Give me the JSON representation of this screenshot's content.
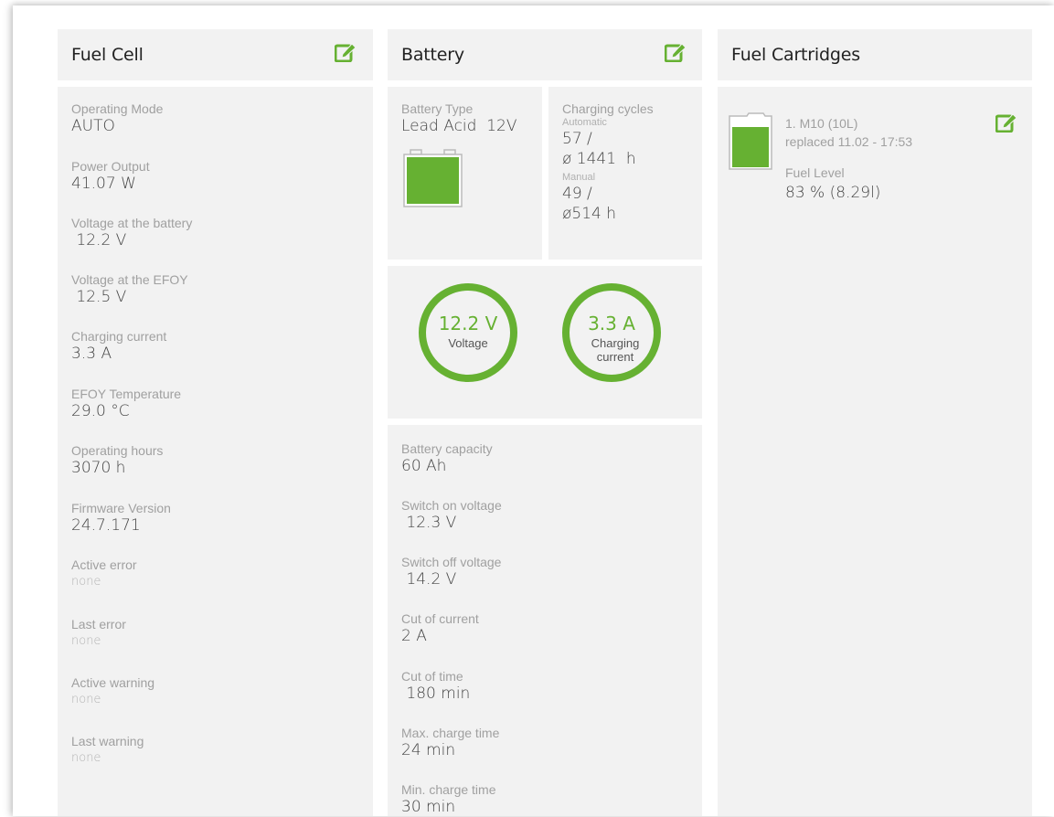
{
  "fuel_cell": {
    "title": "Fuel Cell",
    "fields": [
      {
        "label": "Operating Mode",
        "value": "AUTO"
      },
      {
        "label": "Power Output",
        "value": "41.07 W"
      },
      {
        "label": "Voltage at the battery",
        "value": " 12.2 V"
      },
      {
        "label": "Voltage at the EFOY",
        "value": " 12.5 V"
      },
      {
        "label": "Charging current",
        "value": "3.3 A"
      },
      {
        "label": "EFOY Temperature",
        "value": "29.0 °C"
      },
      {
        "label": "Operating hours",
        "value": "3070 h"
      },
      {
        "label": "Firmware Version",
        "value": "24.7.171"
      },
      {
        "label": "Active error",
        "value": "none"
      },
      {
        "label": "Last error",
        "value": "none"
      },
      {
        "label": "Active warning",
        "value": "none"
      },
      {
        "label": "Last warning",
        "value": "none"
      }
    ]
  },
  "battery": {
    "title": "Battery",
    "type_label": "Battery Type",
    "type_value": "Lead Acid  12V",
    "cycles_label": "Charging cycles",
    "automatic_label": "Automatic",
    "automatic_count": "57 /",
    "automatic_hours": "ø 1441  h",
    "manual_label": "Manual",
    "manual_count": "49 /",
    "manual_hours": "ø514 h",
    "voltage_gauge": {
      "value": "12.2 V",
      "label": "Voltage"
    },
    "current_gauge": {
      "value": "3.3 A",
      "label": "Charging current"
    },
    "settings": [
      {
        "label": "Battery capacity",
        "value": "60 Ah"
      },
      {
        "label": "Switch on voltage",
        "value": " 12.3 V"
      },
      {
        "label": "Switch off voltage",
        "value": " 14.2 V"
      },
      {
        "label": "Cut of current",
        "value": "2 A"
      },
      {
        "label": "Cut of time",
        "value": " 180 min"
      },
      {
        "label": "Max. charge time",
        "value": "24 min"
      },
      {
        "label": "Min. charge time",
        "value": "30 min"
      }
    ]
  },
  "cartridges": {
    "title": "Fuel Cartridges",
    "items": [
      {
        "name": "1. M10 (10L)",
        "replaced": "replaced 11.02 - 17:53",
        "fuel_label": "Fuel Level",
        "fuel_value": "83 % (8.29l)",
        "fill_fraction": 0.83
      }
    ]
  },
  "colors": {
    "accent": "#66b132",
    "panel": "#f2f2f2"
  },
  "icons": {
    "edit": "edit-icon"
  }
}
